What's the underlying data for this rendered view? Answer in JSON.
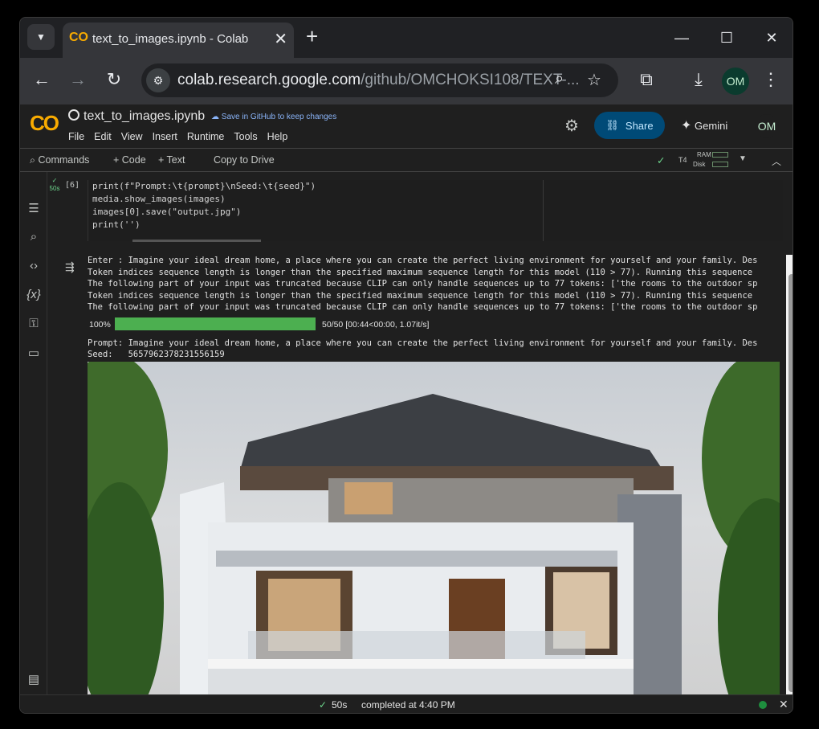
{
  "browser": {
    "tab_title": "text_to_images.ipynb - Colab",
    "tab_logo": "co",
    "new_tab": "+",
    "close_tab": "✕",
    "url_host": "colab.research.google.com",
    "url_path": "/github/OMCHOKSI108/TEXT-...",
    "profile_initials": "OM"
  },
  "colab": {
    "logo": "CO",
    "notebook_name": "text_to_images.ipynb",
    "save_github": "Save in GitHub to keep changes",
    "menus": [
      "File",
      "Edit",
      "View",
      "Insert",
      "Runtime",
      "Tools",
      "Help"
    ],
    "share_label": "Share",
    "gemini_label": "Gemini",
    "user_initials": "OM"
  },
  "toolbar": {
    "commands": "Commands",
    "add_code": "+ Code",
    "add_text": "+ Text",
    "copy_drive": "Copy to Drive",
    "runtime": "T4",
    "ram": "RAM",
    "disk": "Disk"
  },
  "cell": {
    "exec_time": "50s",
    "number": "[6]",
    "code": [
      "print(f\"Prompt:\\t{prompt}\\nSeed:\\t{seed}\")",
      "media.show_images(images)",
      "images[0].save(\"output.jpg\")",
      "print('')"
    ]
  },
  "output": {
    "lines_before": [
      "Enter : Imagine your ideal dream home, a place where you can create the perfect living environment for yourself and your family. Des",
      "Token indices sequence length is longer than the specified maximum sequence length for this model (110 > 77). Running this sequence",
      "The following part of your input was truncated because CLIP can only handle sequences up to 77 tokens: ['the rooms to the outdoor sp",
      "Token indices sequence length is longer than the specified maximum sequence length for this model (110 > 77). Running this sequence",
      "The following part of your input was truncated because CLIP can only handle sequences up to 77 tokens: ['the rooms to the outdoor sp"
    ],
    "progress_pct": "100%",
    "progress_value": 1.0,
    "progress_stats": "50/50  [00:44<00:00,   1.07it/s]",
    "lines_after": [
      "Prompt: Imagine your ideal dream home, a place where you can create the perfect living environment for yourself and your family. Des",
      "Seed:   5657962378231556159"
    ]
  },
  "status": {
    "check": "✓",
    "time": "50s",
    "completed": "completed at 4:40 PM",
    "indicator_color": "#1e8e3e"
  },
  "colors": {
    "accent": "#f9ab00",
    "share_bg": "#004a77",
    "progress": "#4caf50"
  }
}
